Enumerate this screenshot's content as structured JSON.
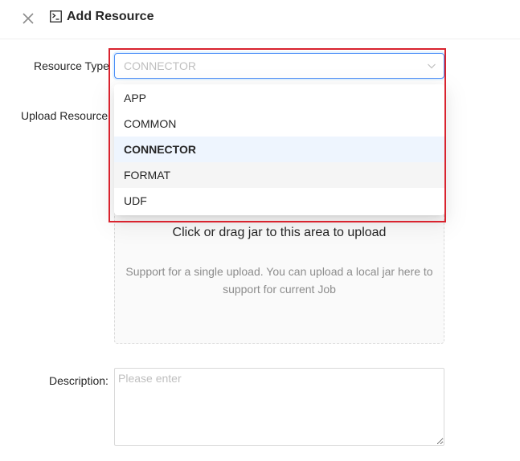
{
  "header": {
    "title": "Add Resource",
    "close_icon": "close-icon",
    "title_icon": "terminal-icon"
  },
  "form": {
    "resource_type": {
      "label": "Resource Type",
      "value": "CONNECTOR",
      "options": [
        "APP",
        "COMMON",
        "CONNECTOR",
        "FORMAT",
        "UDF"
      ],
      "selected_option": "CONNECTOR",
      "hovered_option": "FORMAT"
    },
    "upload_resource": {
      "label": "Upload Resource",
      "title": "Click or drag jar to this area to upload",
      "hint": "Support for a single upload. You can upload a local jar here to support for current Job"
    },
    "description": {
      "label": "Description",
      "colon": ":",
      "placeholder": "Please enter"
    }
  },
  "colors": {
    "accent": "#4d8ff8",
    "highlight_border": "#d9232e",
    "selected_bg": "#eef5fe"
  }
}
